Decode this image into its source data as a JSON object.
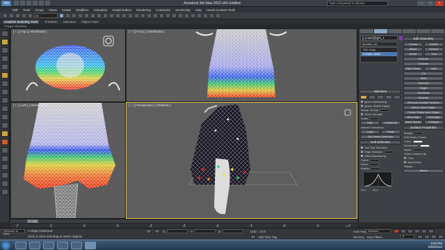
{
  "window": {
    "title": "Autodesk 3ds Max 2012 x64     Untitled",
    "search_placeholder": "Type a keyword or phrase",
    "app_icon_label": "3ds"
  },
  "menu": [
    "Edit",
    "Tools",
    "Group",
    "Views",
    "Create",
    "Modifiers",
    "Animation",
    "Graph Editors",
    "Rendering",
    "Customize",
    "MAXScript",
    "Help",
    "Havok Content Tools"
  ],
  "toolbar": {
    "selection_filter": "All"
  },
  "ribbon": {
    "tabs": [
      "Graphite Modeling Tools",
      "Freeform",
      "Selection",
      "Object Paint"
    ],
    "active_tab": "Graphite Modeling Tools",
    "sub": "Polygon Modeling"
  },
  "viewports": {
    "top": "[ + ] [ Top ] [ Wireframe ]",
    "front": "[ + ] [ Front ] [ Wireframe ]",
    "left": "[ + ] [ Left ] [ Wireframe ]",
    "perspective": "[ + ] [ Perspective ] [ Realistic ]"
  },
  "command_panel": {
    "object_name": "[Lunable]light_1",
    "modifier_list": "Modifier List",
    "stack": [
      "Skin Wrap",
      "Editable Mesh"
    ],
    "right_buttons": [
      [
        "Edit Geometry",
        ""
      ],
      [
        "Create",
        "Delete"
      ],
      [
        "Attach",
        "Detach"
      ],
      [
        "Divide",
        "Turn"
      ],
      [
        "Extrude",
        ""
      ],
      [
        "Chamfer",
        ""
      ],
      [
        "Slice Plane",
        "Split"
      ],
      [
        "Cut",
        ""
      ],
      [
        "Weld",
        ""
      ],
      [
        "Selected",
        ""
      ],
      [
        "Target",
        ""
      ],
      [
        "Tessellate",
        ""
      ],
      [
        "Explode",
        ""
      ],
      [
        "Remove Isolated Vertices",
        ""
      ],
      [
        "Select Open Edges",
        ""
      ],
      [
        "Create Shape from Edges",
        ""
      ],
      [
        "View Align",
        "Grid Align"
      ],
      [
        "Make Planar",
        "Collapse"
      ]
    ],
    "selection": {
      "header": "Selection",
      "ignore_backfacing": "Ignore Backfacing",
      "ignore_visible": "Ignore Visible Edges",
      "planar_thresh": "Planar Thresh",
      "show_normals": "Show Normals",
      "scale": "Scale",
      "hide": "Hide",
      "unhide_all": "Unhide All",
      "named_selections": "Named Selections:",
      "copy": "Copy",
      "paste": "Paste",
      "get_vertex": "Get Vertex Selection"
    },
    "soft_selection": {
      "header": "Soft Selection",
      "use": "Use Soft Selection",
      "edge_distance": "Edge Distance",
      "affect_backfacing": "Affect Backfacing",
      "falloff": "Falloff",
      "pinch": "Pinch",
      "bubble": "Bubble",
      "curve_left": "20.0",
      "curve_right": "20.0"
    },
    "surface": {
      "header": "Surface Properties",
      "weight": "Weight",
      "edit_vertex_colors": "Edit Vertex Colors",
      "color": "Color:",
      "illumination": "Illumination:",
      "alpha": "Alpha:",
      "select_vertex_by": "Select Vertices By",
      "color_radio": "Color",
      "illumination_radio": "Illumination",
      "range": "Range:",
      "select": "Select",
      "r": "R:",
      "g": "G:",
      "b": "B:"
    }
  },
  "timeline": {
    "frame": "0 / 100",
    "ticks": [
      "0",
      "10",
      "20",
      "30",
      "40",
      "50",
      "60",
      "70",
      "80",
      "90",
      "100"
    ]
  },
  "status": {
    "selected": "1 Object Selected",
    "prompt": "Click or click-and-drag to select objects",
    "x": "X:",
    "y": "Y:",
    "z": "Z:",
    "grid": "Grid = 10.0",
    "auto_key": "Auto Key",
    "selected_dd": "Selected",
    "set_key": "Set Key",
    "key_filters": "Key Filters...",
    "add_time_tag": "Add Time Tag",
    "frame_value": "0",
    "welcome": "Welcome to MAX"
  },
  "taskbar": {
    "time": "3:53 PM",
    "date": "6/25/2012"
  },
  "colors": {
    "viewport_bg": "#5b5b5b",
    "active_border": "#e6c84a",
    "selected_stack": "#4f78b0"
  }
}
